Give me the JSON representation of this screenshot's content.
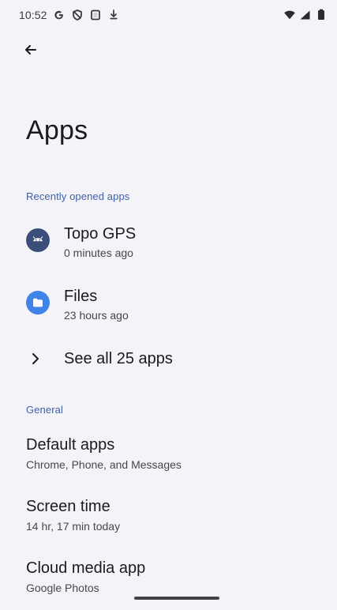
{
  "status_bar": {
    "time": "10:52",
    "left_icons": [
      "google-g-icon",
      "vpn-shield-icon",
      "screen-record-icon",
      "download-icon"
    ],
    "right_icons": [
      "wifi-icon",
      "cell-signal-icon",
      "battery-icon"
    ]
  },
  "page": {
    "title": "Apps",
    "back_icon": "back-arrow-icon"
  },
  "sections": {
    "recent": {
      "header": "Recently opened apps",
      "apps": [
        {
          "name": "Topo GPS",
          "subtitle": "0 minutes ago",
          "icon": "android-icon",
          "icon_color": "#3b4d79"
        },
        {
          "name": "Files",
          "subtitle": "23 hours ago",
          "icon": "folder-icon",
          "icon_color": "#3f84e6"
        }
      ],
      "see_all": {
        "label": "See all 25 apps",
        "icon": "chevron-right-icon"
      }
    },
    "general": {
      "header": "General",
      "items": [
        {
          "title": "Default apps",
          "summary": "Chrome, Phone, and Messages"
        },
        {
          "title": "Screen time",
          "summary": "14 hr, 17 min today"
        },
        {
          "title": "Cloud media app",
          "summary": "Google Photos"
        }
      ]
    }
  },
  "colors": {
    "background": "#f4f3f8",
    "accent": "#3f5fa5",
    "text_primary": "#1b1b1f",
    "text_secondary": "#46464b"
  }
}
